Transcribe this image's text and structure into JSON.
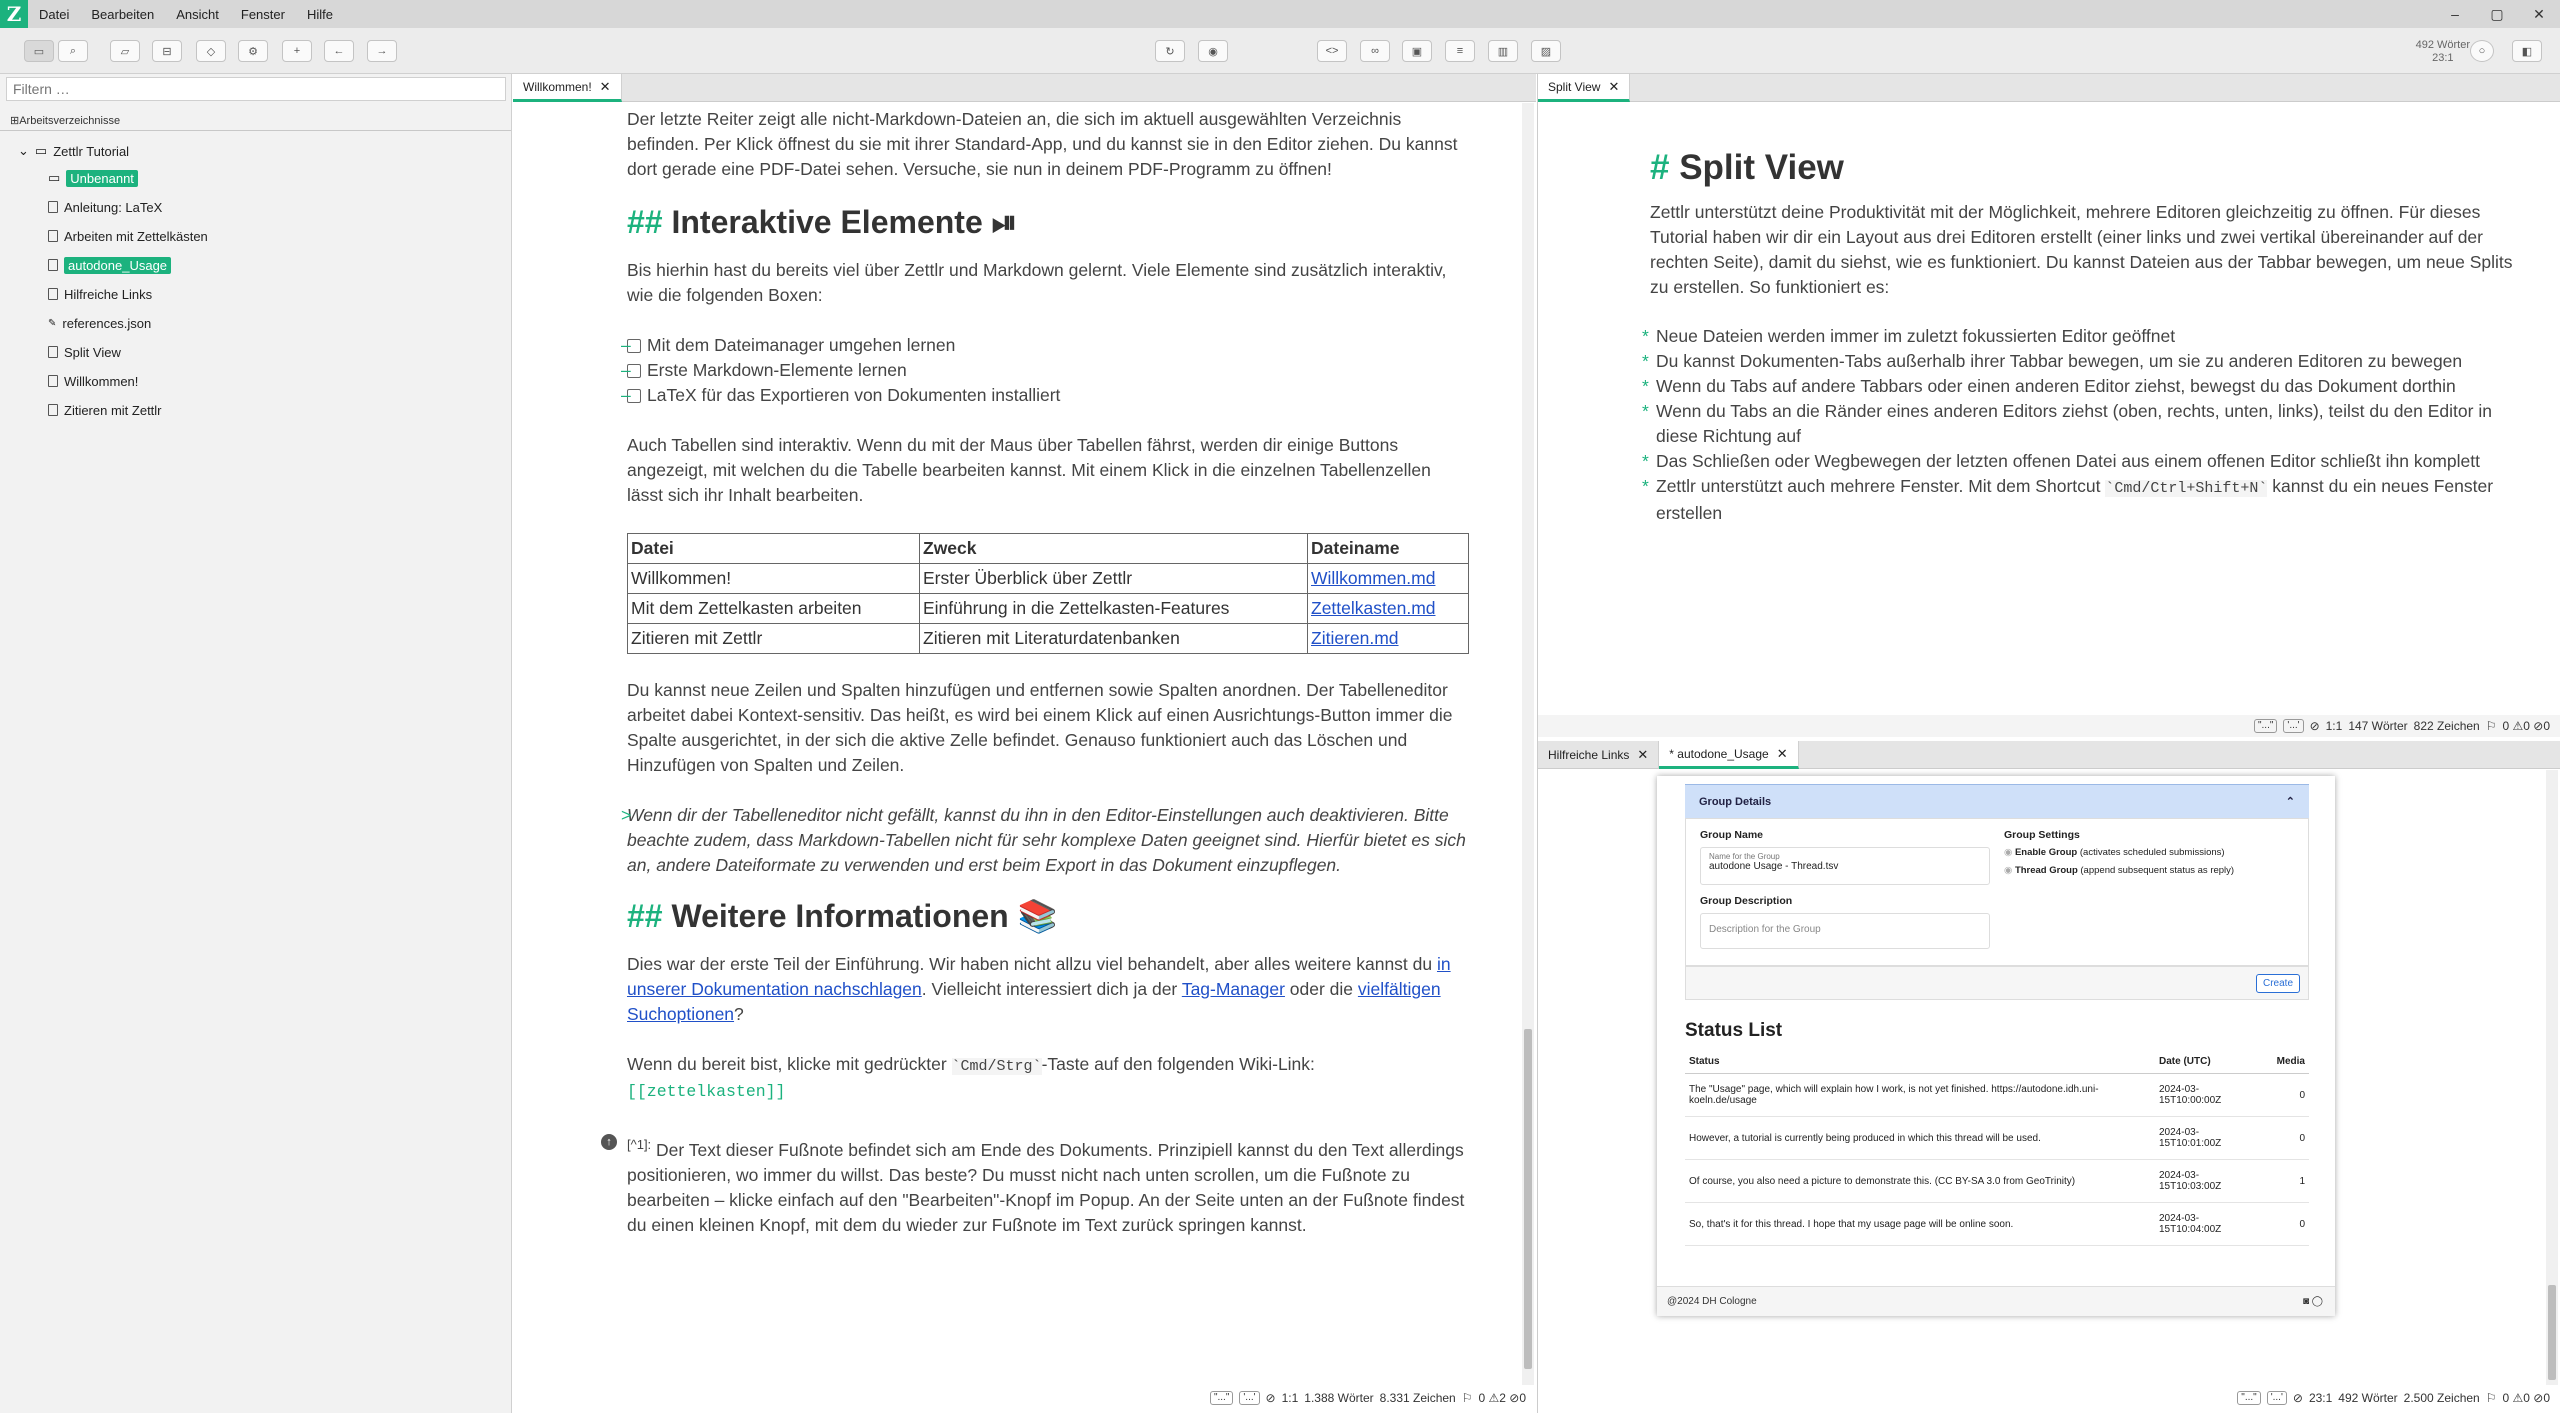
{
  "app": {
    "logo": "Z"
  },
  "menubar": {
    "items": [
      "Datei",
      "Bearbeiten",
      "Ansicht",
      "Fenster",
      "Hilfe"
    ]
  },
  "toolbar": {
    "word_count": "492 Wörter",
    "cursor": "23:1"
  },
  "sidebar": {
    "filter_placeholder": "Filtern …",
    "workspaces_label": "Arbeitsverzeichnisse",
    "root": "Zettlr Tutorial",
    "items": [
      {
        "label": "Unbenannt",
        "type": "folder",
        "highlight": true
      },
      {
        "label": "Anleitung: LaTeX",
        "type": "file",
        "highlight": false
      },
      {
        "label": "Arbeiten mit Zettelkästen",
        "type": "file",
        "highlight": false
      },
      {
        "label": "autodone_Usage",
        "type": "file",
        "highlight": true
      },
      {
        "label": "Hilfreiche Links",
        "type": "file",
        "highlight": false
      },
      {
        "label": "references.json",
        "type": "json",
        "highlight": false
      },
      {
        "label": "Split View",
        "type": "file",
        "highlight": false
      },
      {
        "label": "Willkommen!",
        "type": "file",
        "highlight": false
      },
      {
        "label": "Zitieren mit Zettlr",
        "type": "file",
        "highlight": false
      }
    ]
  },
  "left_editor": {
    "tab": "Willkommen!",
    "para1": "Der letzte Reiter zeigt alle nicht-Markdown-Dateien an, die sich im aktuell ausgewählten Verzeichnis befinden. Per Klick öffnest du sie mit ihrer Standard-App, und du kannst sie in den Editor ziehen. Du kannst dort gerade eine PDF-Datei sehen. Versuche, sie nun in deinem PDF-Programm zu öffnen!",
    "heading_mark": "##",
    "heading1": "Interaktive Elemente ⏯",
    "para2": "Bis hierhin hast du bereits viel über Zettlr und Markdown gelernt. Viele Elemente sind zusätzlich interaktiv, wie die folgenden Boxen:",
    "tasks": [
      "Mit dem Dateimanager umgehen lernen",
      "Erste Markdown-Elemente lernen",
      "LaTeX für das Exportieren von Dokumenten installiert"
    ],
    "para3": "Auch Tabellen sind interaktiv. Wenn du mit der Maus über Tabellen fährst, werden dir einige Buttons angezeigt, mit welchen du die Tabelle bearbeiten kannst. Mit einem Klick in die einzelnen Tabellenzellen lässt sich ihr Inhalt bearbeiten.",
    "table": {
      "headers": [
        "Datei",
        "Zweck",
        "Dateiname"
      ],
      "rows": [
        [
          "Willkommen!",
          "Erster Überblick über Zettlr",
          "Willkommen.md"
        ],
        [
          "Mit dem Zettelkasten arbeiten",
          "Einführung in die Zettelkasten-Features",
          "Zettelkasten.md"
        ],
        [
          "Zitieren mit Zettlr",
          "Zitieren mit Literaturdatenbanken",
          "Zitieren.md"
        ]
      ]
    },
    "para4": "Du kannst neue Zeilen und Spalten hinzufügen und entfernen sowie Spalten anordnen. Der Tabelleneditor arbeitet dabei Kontext-sensitiv. Das heißt, es wird bei einem Klick auf einen Ausrichtungs-Button immer die Spalte ausgerichtet, in der sich die aktive Zelle befindet. Genauso funktioniert auch das Löschen und Hinzufügen von Spalten und Zeilen.",
    "quote_mark": ">",
    "quote": "Wenn dir der Tabelleneditor nicht gefällt, kannst du ihn in den Editor-Einstellungen auch deaktivieren. Bitte beachte zudem, dass Markdown-Tabellen nicht für sehr komplexe Daten geeignet sind. Hierfür bietet es sich an, andere Dateiformate zu verwenden und erst beim Export in das Dokument einzupflegen.",
    "heading2": "Weitere Informationen 📚",
    "para5_a": "Dies war der erste Teil der Einführung. Wir haben nicht allzu viel behandelt, aber alles weitere kannst du ",
    "para5_link1": "in unserer Dokumentation nachschlagen",
    "para5_b": ". Vielleicht interessiert dich ja der ",
    "para5_link2": "Tag-Manager",
    "para5_c": " oder die ",
    "para5_link3": "vielfältigen Suchoptionen",
    "para5_d": "?",
    "para6_a": "Wenn du bereit bist, klicke mit gedrückter ",
    "para6_code": "`Cmd/Strg`",
    "para6_b": "-Taste auf den folgenden Wiki-Link:",
    "wiki_link": "[[zettelkasten]]",
    "footnote_ref": "[^1]:",
    "footnote": " Der Text dieser Fußnote befindet sich am Ende des Dokuments. Prinzipiell kannst du den Text allerdings positionieren, wo immer du willst. Das beste? Du musst nicht nach unten scrollen, um die Fußnote zu bearbeiten – klicke einfach auf den \"Bearbeiten\"-Knopf im Popup. An der Seite unten an der Fußnote findest du einen kleinen Knopf, mit dem du wieder zur Fußnote im Text zurück springen kannst.",
    "status": {
      "kb1": "\"...\"",
      "kb2": "'...'",
      "cursor": "1:1",
      "words": "1.388 Wörter",
      "chars": "8.331 Zeichen",
      "counts": "0 ⚠2 ⊘0"
    }
  },
  "split_editor": {
    "tab": "Split View",
    "heading_mark": "#",
    "heading": "Split View",
    "para": "Zettlr unterstützt deine Produktivität mit der Möglichkeit, mehrere Editoren gleichzeitig zu öffnen. Für dieses Tutorial haben wir dir ein Layout aus drei Editoren erstellt (einer links und zwei vertikal übereinander auf der rechten Seite), damit du siehst, wie es funktioniert. Du kannst Dateien aus der Tabbar bewegen, um neue Splits zu erstellen. So funktioniert es:",
    "bullets": [
      "Neue Dateien werden immer im zuletzt fokussierten Editor geöffnet",
      "Du kannst Dokumenten-Tabs außerhalb ihrer Tabbar bewegen, um sie zu anderen Editoren zu bewegen",
      "Wenn du Tabs auf andere Tabbars oder einen anderen Editor ziehst, bewegst du das Dokument dorthin",
      "Wenn du Tabs an die Ränder eines anderen Editors ziehst (oben, rechts, unten, links), teilst du den Editor in diese Richtung auf",
      "Das Schließen oder Wegbewegen der letzten offenen Datei aus einem offenen Editor schließt ihn komplett"
    ],
    "bullet6_a": "Zettlr unterstützt auch mehrere Fenster. Mit dem Shortcut ",
    "bullet6_code": "`Cmd/Ctrl+Shift+N`",
    "bullet6_b": " kannst du ein neues Fenster erstellen",
    "status": {
      "kb1": "\"...\"",
      "kb2": "'...'",
      "cursor": "1:1",
      "words": "147 Wörter",
      "chars": "822 Zeichen",
      "counts": "0 ⚠0 ⊘0"
    }
  },
  "bottom_editor": {
    "tab1": "Hilfreiche Links",
    "tab2": "* autodone_Usage",
    "status": {
      "kb1": "\"...\"",
      "kb2": "'...'",
      "cursor": "23:1",
      "words": "492 Wörter",
      "chars": "2.500 Zeichen",
      "counts": "0 ⚠0 ⊘0"
    },
    "embedded": {
      "group_details": "Group Details",
      "group_name_label": "Group Name",
      "group_name_small": "Name for the Group",
      "group_name_value": "autodone Usage - Thread.tsv",
      "group_desc_label": "Group Description",
      "group_desc_placeholder": "Description for the Group",
      "group_settings_label": "Group Settings",
      "enable_group": "Enable Group",
      "enable_group_hint": "(activates scheduled submissions)",
      "thread_group": "Thread Group",
      "thread_group_hint": "(append subsequent status as reply)",
      "create_button": "Create",
      "status_list_title": "Status List",
      "columns": [
        "Status",
        "Date (UTC)",
        "Media"
      ],
      "rows": [
        [
          "The \"Usage\" page, which will explain how I work, is not yet finished. https://autodone.idh.uni-koeln.de/usage",
          "2024-03-15T10:00:00Z",
          "0"
        ],
        [
          "However, a tutorial is currently being produced in which this thread will be used.",
          "2024-03-15T10:01:00Z",
          "0"
        ],
        [
          "Of course, you also need a picture to demonstrate this. (CC BY-SA 3.0 from GeoTrinity)",
          "2024-03-15T10:03:00Z",
          "1"
        ],
        [
          "So, that's it for this thread. I hope that my usage page will be online soon.",
          "2024-03-15T10:04:00Z",
          "0"
        ]
      ],
      "footer": "@2024  DH Cologne"
    }
  }
}
